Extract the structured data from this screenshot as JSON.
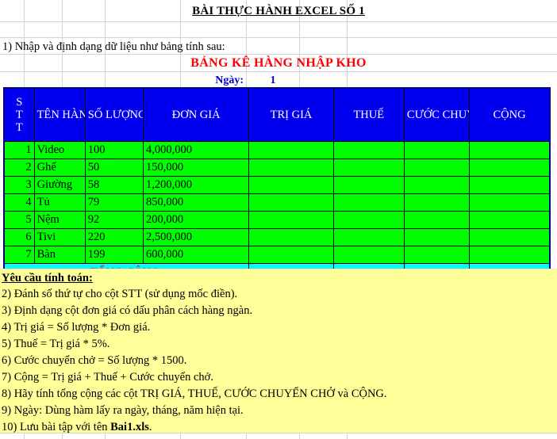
{
  "document": {
    "title": "BÀI THỰC HÀNH EXCEL SỐ 1",
    "instruction_line": "1) Nhập và định dạng dữ liệu như bảng tính sau:",
    "table_title": "BẢNG KÊ HÀNG NHẬP KHO",
    "date_label": "Ngày:",
    "date_value": "1"
  },
  "colors": {
    "header_bg": "#0000EE",
    "header_text": "#FFFFFF",
    "data_bg": "#00FF00",
    "empty_bg": "#00FFFF",
    "title_red": "#FF0000",
    "date_blue": "#0000CC",
    "notes_bg": "#FFFF99",
    "border": "#000000"
  },
  "table": {
    "headers": {
      "stt": [
        "S",
        "T",
        "T"
      ],
      "ten_hang": "TÊN HÀNG",
      "so_luong": "SỐ LƯỢNG",
      "don_gia": "ĐƠN GIÁ",
      "tri_gia": "TRỊ GIÁ",
      "thue": "THUẾ",
      "cuoc_chuyen_cho": "CƯỚC CHUYỂN CHỞ",
      "cong": "CỘNG"
    },
    "rows": [
      {
        "stt": "1",
        "ten_hang": "Video",
        "so_luong": "100",
        "don_gia": "4,000,000",
        "tri_gia": "",
        "thue": "",
        "cuoc": "",
        "cong": ""
      },
      {
        "stt": "2",
        "ten_hang": "Ghế",
        "so_luong": "50",
        "don_gia": "150,000",
        "tri_gia": "",
        "thue": "",
        "cuoc": "",
        "cong": ""
      },
      {
        "stt": "3",
        "ten_hang": "Giường",
        "so_luong": "58",
        "don_gia": "1,200,000",
        "tri_gia": "",
        "thue": "",
        "cuoc": "",
        "cong": ""
      },
      {
        "stt": "4",
        "ten_hang": "Tủ",
        "so_luong": "79",
        "don_gia": "850,000",
        "tri_gia": "",
        "thue": "",
        "cuoc": "",
        "cong": ""
      },
      {
        "stt": "5",
        "ten_hang": "Nệm",
        "so_luong": "92",
        "don_gia": "200,000",
        "tri_gia": "",
        "thue": "",
        "cuoc": "",
        "cong": ""
      },
      {
        "stt": "6",
        "ten_hang": "Tivi",
        "so_luong": "220",
        "don_gia": "2,500,000",
        "tri_gia": "",
        "thue": "",
        "cuoc": "",
        "cong": ""
      },
      {
        "stt": "7",
        "ten_hang": "Bàn",
        "so_luong": "199",
        "don_gia": "600,000",
        "tri_gia": "",
        "thue": "",
        "cuoc": "",
        "cong": ""
      }
    ],
    "total_row": {
      "label": "TỔNG CỘNG:",
      "tri_gia": "",
      "thue": "",
      "cuoc": "",
      "cong": ""
    }
  },
  "requirements": {
    "heading": "Yêu cầu tính toán:",
    "items": [
      "2) Đánh số thứ tự cho cột STT (sử dụng mốc điền).",
      "3) Định dạng cột đơn giá có dấu phân cách hàng ngàn.",
      "4) Trị giá = Số lượng * Đơn giá.",
      "5) Thuế = Trị giá * 5%.",
      "6) Cước chuyển chở = Số lượng * 1500.",
      "7) Cộng = Trị giá + Thuế + Cước chuyển chở.",
      "8) Hãy tính tổng cộng các cột TRỊ GIÁ, THUẾ, CƯỚC CHUYỂN CHỞ và CỘNG.",
      "9) Ngày: Dùng hàm lấy ra ngày, tháng, năm hiện tại."
    ],
    "last_item": {
      "prefix": "10) Lưu bài tập với tên ",
      "filename": "Bai1.xls",
      "suffix": "."
    }
  }
}
